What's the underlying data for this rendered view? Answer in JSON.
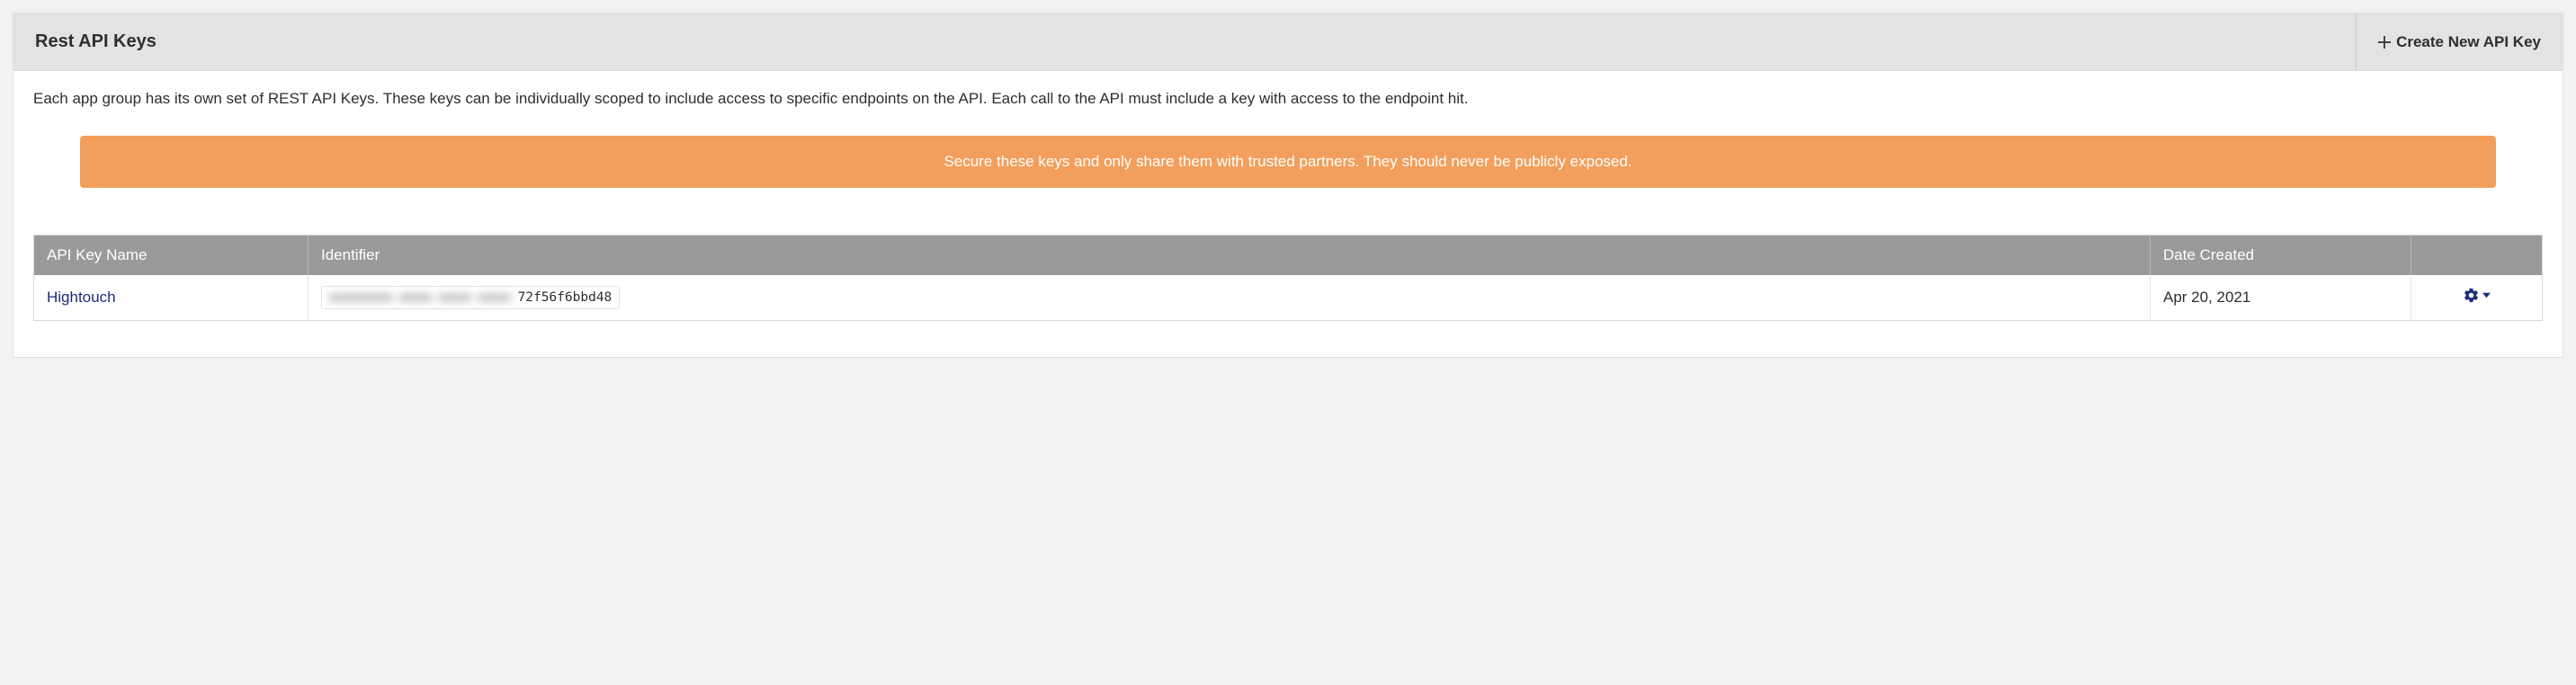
{
  "header": {
    "title": "Rest API Keys",
    "create_label": "Create New API Key"
  },
  "body": {
    "description": "Each app group has its own set of REST API Keys. These keys can be individually scoped to include access to specific endpoints on the API. Each call to the API must include a key with access to the endpoint hit.",
    "warning": "Secure these keys and only share them with trusted partners. They should never be publicly exposed."
  },
  "table": {
    "columns": {
      "name": "API Key Name",
      "identifier": "Identifier",
      "date": "Date Created",
      "actions": ""
    },
    "rows": [
      {
        "name": "Hightouch",
        "identifier_hidden": "xxxxxxxx-xxxx-xxxx-xxxx-",
        "identifier_visible": "72f56f6bbd48",
        "date": "Apr 20, 2021"
      }
    ]
  }
}
